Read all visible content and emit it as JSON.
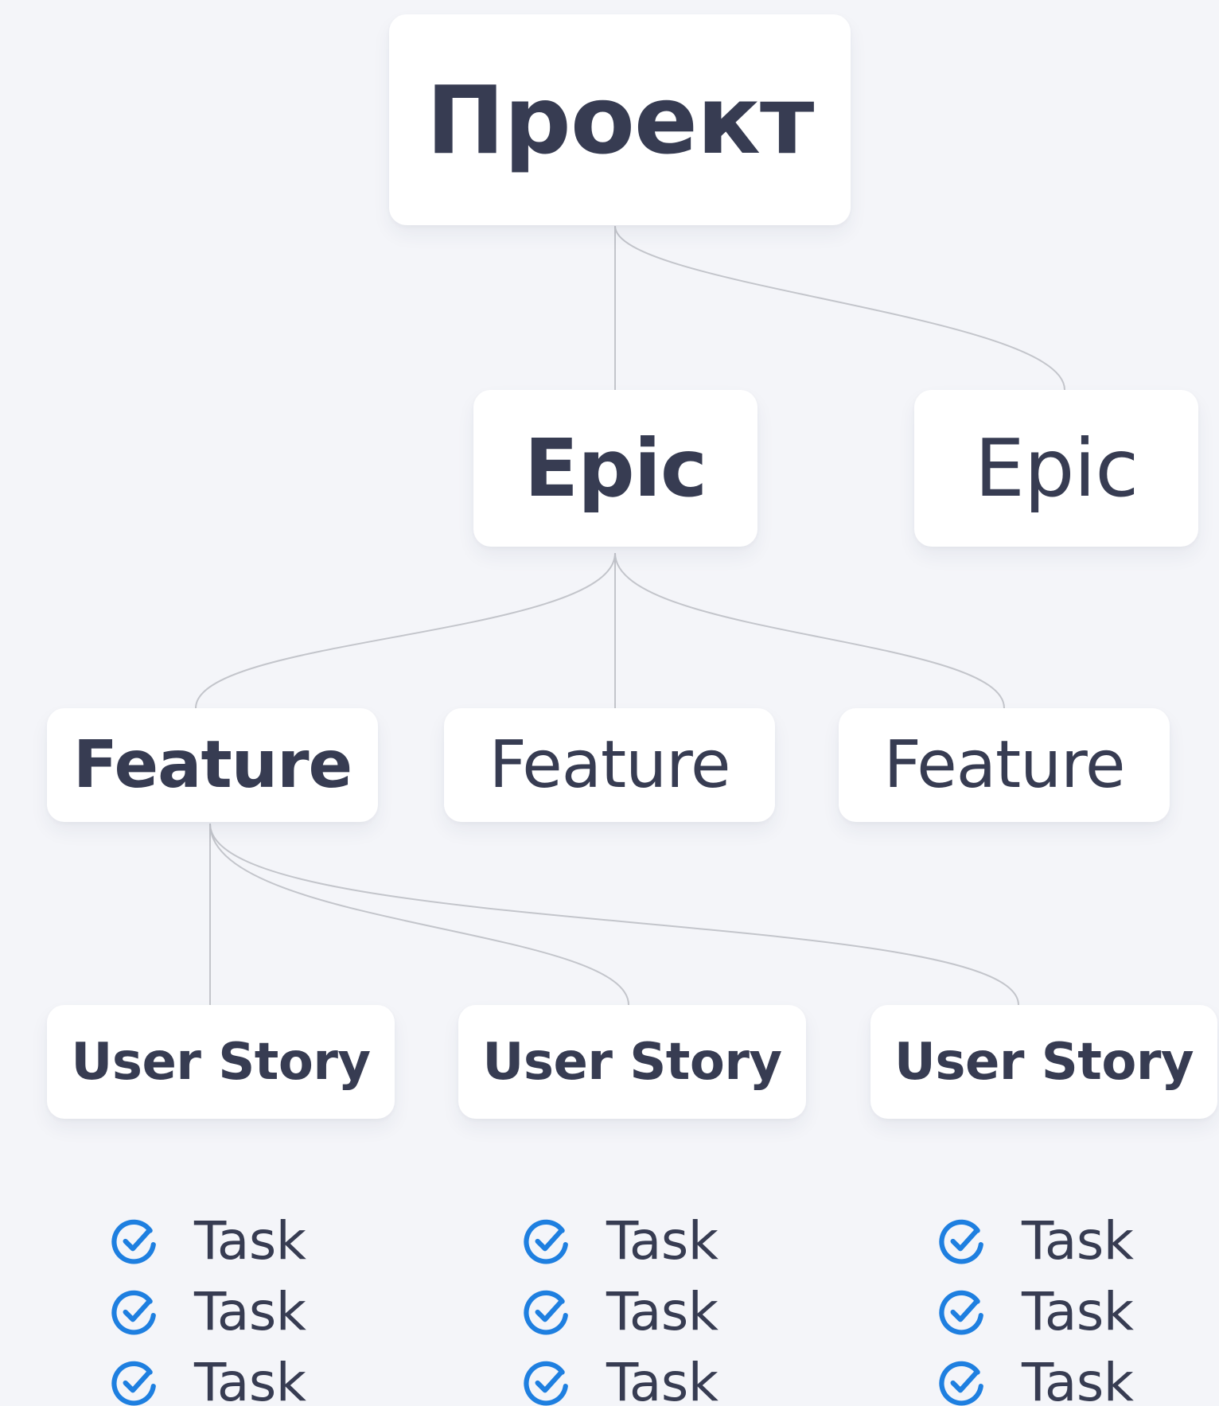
{
  "colors": {
    "background": "#f4f5f9",
    "card": "#ffffff",
    "text": "#373c52",
    "connector": "#c3c5cb",
    "task_icon": "#1e7fe0"
  },
  "diagram": {
    "root": {
      "label": "Проект"
    },
    "epics": [
      {
        "label": "Epic",
        "emphasis": "bold"
      },
      {
        "label": "Epic",
        "emphasis": "regular"
      }
    ],
    "features": [
      {
        "label": "Feature",
        "emphasis": "bold"
      },
      {
        "label": "Feature",
        "emphasis": "regular"
      },
      {
        "label": "Feature",
        "emphasis": "regular"
      }
    ],
    "user_stories": [
      {
        "label": "User Story"
      },
      {
        "label": "User Story"
      },
      {
        "label": "User Story"
      }
    ],
    "task_columns": [
      {
        "tasks": [
          {
            "label": "Task",
            "icon": "check-circle-icon"
          },
          {
            "label": "Task",
            "icon": "check-circle-icon"
          },
          {
            "label": "Task",
            "icon": "check-circle-icon"
          }
        ]
      },
      {
        "tasks": [
          {
            "label": "Task",
            "icon": "check-circle-icon"
          },
          {
            "label": "Task",
            "icon": "check-circle-icon"
          },
          {
            "label": "Task",
            "icon": "check-circle-icon"
          }
        ]
      },
      {
        "tasks": [
          {
            "label": "Task",
            "icon": "check-circle-icon"
          },
          {
            "label": "Task",
            "icon": "check-circle-icon"
          },
          {
            "label": "Task",
            "icon": "check-circle-icon"
          }
        ]
      }
    ]
  }
}
